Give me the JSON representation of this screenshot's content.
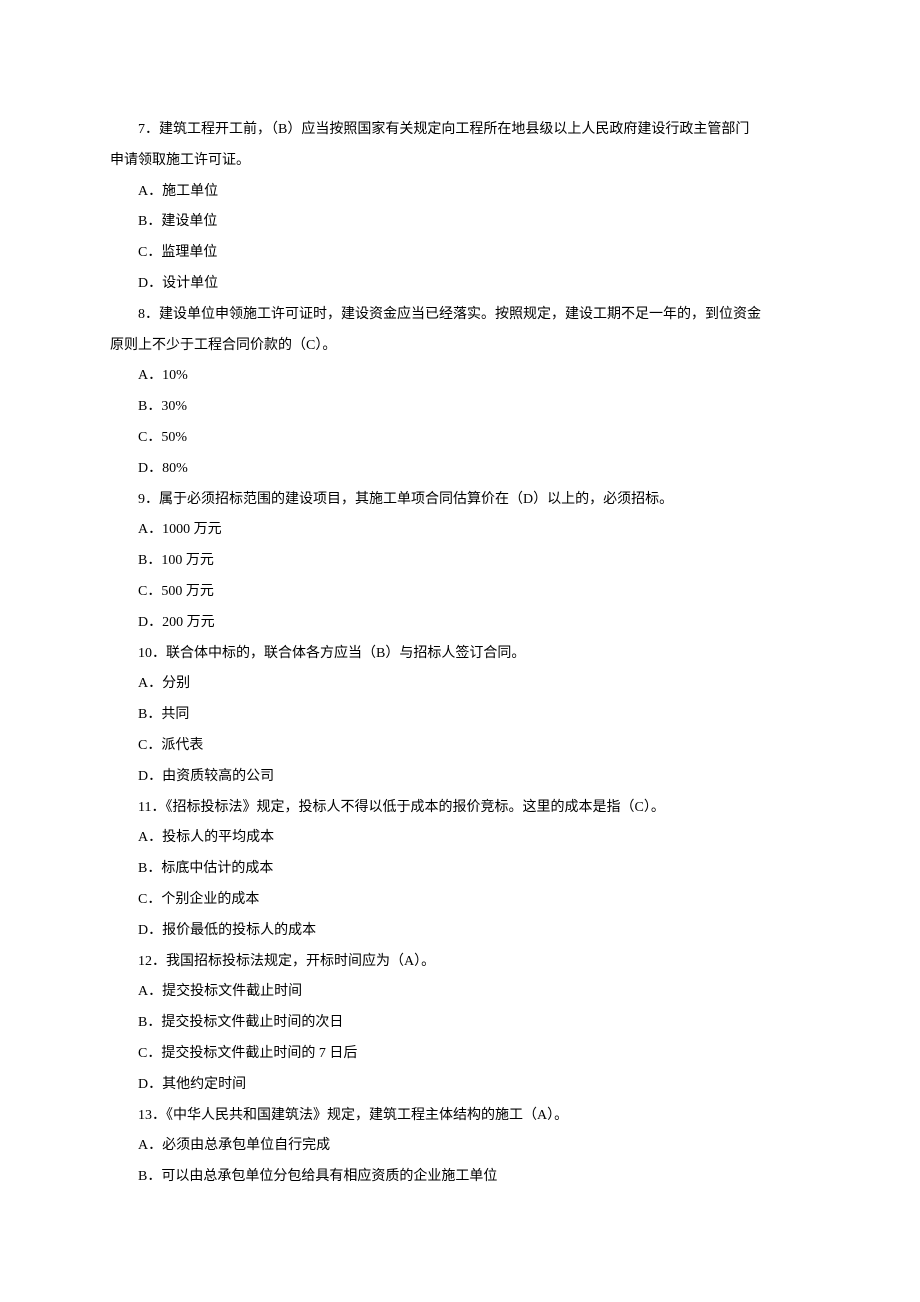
{
  "questions": [
    {
      "number": "7",
      "text_line1": "7．建筑工程开工前，（B）应当按照国家有关规定向工程所在地县级以上人民政府建设行政主管部门",
      "text_line2": "申请领取施工许可证。",
      "options": [
        "A．施工单位",
        "B．建设单位",
        "C．监理单位",
        "D．设计单位"
      ]
    },
    {
      "number": "8",
      "text_line1": "8．建设单位申领施工许可证时，建设资金应当已经落实。按照规定，建设工期不足一年的，到位资金",
      "text_line2": "原则上不少于工程合同价款的（C）。",
      "options": [
        "A．10%",
        "B．30%",
        "C．50%",
        "D．80%"
      ]
    },
    {
      "number": "9",
      "text_line1": "9．属于必须招标范围的建设项目，其施工单项合同估算价在（D）以上的，必须招标。",
      "options": [
        "A．1000 万元",
        "B．100 万元",
        "C．500 万元",
        "D．200 万元"
      ]
    },
    {
      "number": "10",
      "text_line1": "10．联合体中标的，联合体各方应当（B）与招标人签订合同。",
      "options": [
        "A．分别",
        "B．共同",
        "C．派代表",
        "D．由资质较高的公司"
      ]
    },
    {
      "number": "11",
      "text_line1": "11．《招标投标法》规定，投标人不得以低于成本的报价竞标。这里的成本是指（C）。",
      "options": [
        "A．投标人的平均成本",
        "B．标底中估计的成本",
        "C．个别企业的成本",
        "D．报价最低的投标人的成本"
      ]
    },
    {
      "number": "12",
      "text_line1": "12．我国招标投标法规定，开标时间应为（A）。",
      "options": [
        "A．提交投标文件截止时间",
        "B．提交投标文件截止时间的次日",
        "C．提交投标文件截止时间的 7 日后",
        "D．其他约定时间"
      ]
    },
    {
      "number": "13",
      "text_line1": "13．《中华人民共和国建筑法》规定，建筑工程主体结构的施工（A）。",
      "options": [
        "A．必须由总承包单位自行完成",
        "B．可以由总承包单位分包给具有相应资质的企业施工单位"
      ]
    }
  ]
}
